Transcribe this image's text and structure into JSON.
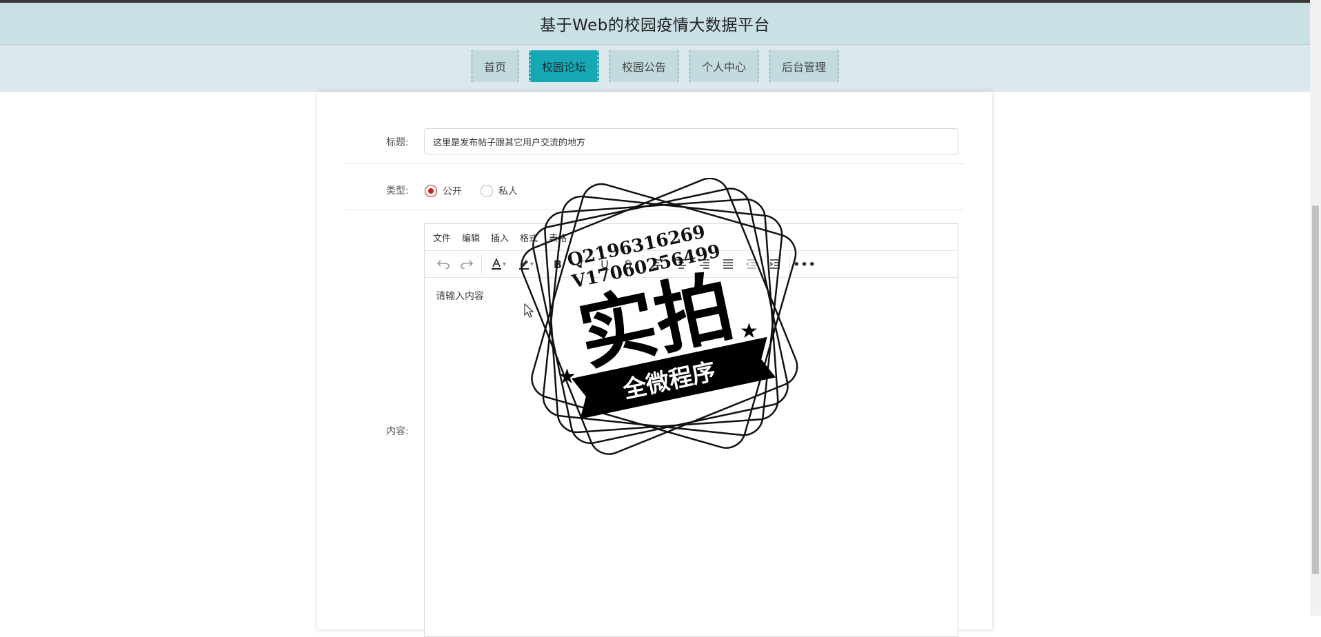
{
  "header": {
    "title": "基于Web的校园疫情大数据平台"
  },
  "nav": {
    "items": [
      {
        "label": "首页"
      },
      {
        "label": "校园论坛"
      },
      {
        "label": "校园公告"
      },
      {
        "label": "个人中心"
      },
      {
        "label": "后台管理"
      }
    ],
    "active": "校园论坛"
  },
  "form": {
    "title_label": "标题:",
    "title_value": "这里是发布帖子跟其它用户交流的地方",
    "type_label": "类型:",
    "type_options": [
      {
        "label": "公开",
        "selected": true
      },
      {
        "label": "私人",
        "selected": false
      }
    ],
    "content_label": "内容:"
  },
  "editor": {
    "menus": [
      "文件",
      "编辑",
      "插入",
      "格式",
      "表格"
    ],
    "placeholder": "请输入内容",
    "toolbar_icons": [
      "undo-icon",
      "redo-icon",
      "font-color-icon",
      "highlight-icon",
      "bold-icon",
      "italic-icon",
      "underline-icon",
      "strikethrough-icon",
      "align-left-icon",
      "align-center-icon",
      "align-right-icon",
      "align-justify-icon",
      "outdent-icon",
      "indent-icon",
      "more-icon"
    ]
  },
  "watermark": {
    "line1": "Q2196316269",
    "line2": "V17060256499",
    "main": "实拍",
    "banner": "全微程序"
  },
  "colors": {
    "header_bg": "#c9e0e4",
    "nav_bg": "#dbe9ee",
    "nav_item_bg": "#c3dbdf",
    "nav_active_bg": "#17a8b5",
    "radio_checked": "#cc2222"
  }
}
